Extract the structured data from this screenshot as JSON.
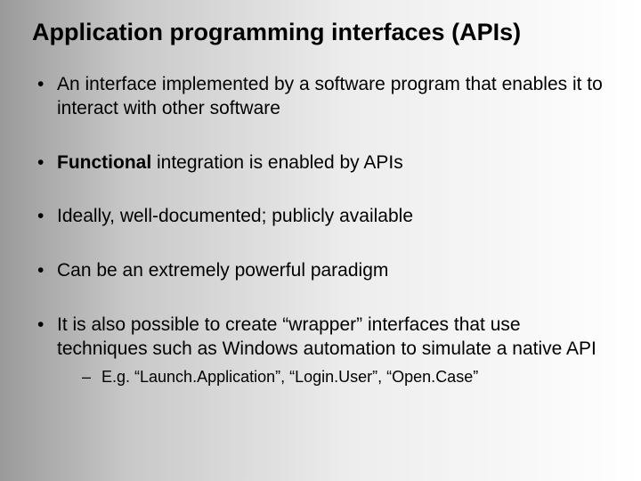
{
  "title": "Application programming interfaces (APIs)",
  "bullets": {
    "b1": "An interface implemented by a software program that enables it to interact with other software",
    "b2_bold": "Functional",
    "b2_rest": " integration is enabled by APIs",
    "b3": "Ideally, well-documented; publicly available",
    "b4": "Can be an extremely powerful paradigm",
    "b5": "It is also possible to create “wrapper” interfaces that use techniques such as Windows automation to simulate a native API",
    "b5_sub": "E.g. “Launch.Application”, “Login.User”, “Open.Case”"
  }
}
